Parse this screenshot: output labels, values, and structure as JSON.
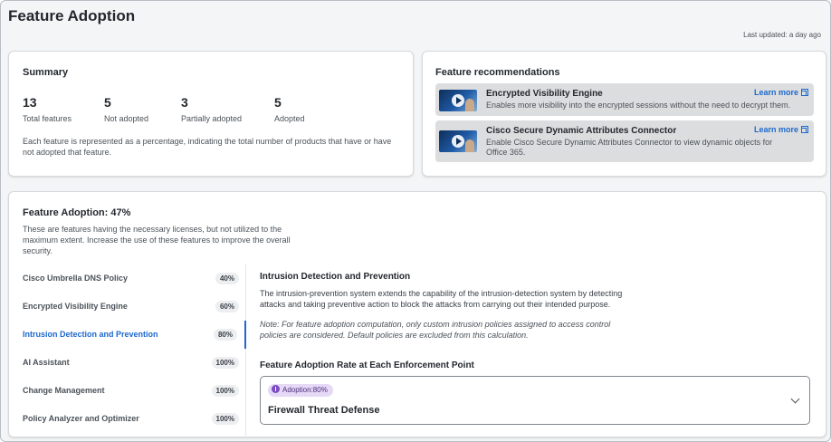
{
  "header": {
    "title": "Feature Adoption",
    "last_updated": "Last updated: a day ago"
  },
  "summary": {
    "title": "Summary",
    "stats": [
      {
        "value": "13",
        "label": "Total features"
      },
      {
        "value": "5",
        "label": "Not adopted"
      },
      {
        "value": "3",
        "label": "Partially adopted"
      },
      {
        "value": "5",
        "label": "Adopted"
      }
    ],
    "note": "Each feature is represented as a percentage, indicating the total number of products that have or have not adopted that feature."
  },
  "recommendations": {
    "title": "Feature recommendations",
    "items": [
      {
        "name": "Encrypted Visibility Engine",
        "description": "Enables more visibility into the encrypted sessions without the need to decrypt them.",
        "link": "Learn more"
      },
      {
        "name": "Cisco Secure Dynamic Attributes Connector",
        "description": "Enable Cisco Secure Dynamic Attributes Connector to view dynamic objects for Office 365.",
        "link": "Learn more"
      }
    ]
  },
  "adoption": {
    "title": "Feature Adoption: 47%",
    "description": "These are features having the necessary licenses, but not utilized to the maximum extent. Increase the use of these features to improve the overall security.",
    "features": [
      {
        "name": "Cisco Umbrella DNS Policy",
        "percent": "40%"
      },
      {
        "name": "Encrypted Visibility Engine",
        "percent": "60%"
      },
      {
        "name": "Intrusion Detection and Prevention",
        "percent": "80%"
      },
      {
        "name": "AI Assistant",
        "percent": "100%"
      },
      {
        "name": "Change Management",
        "percent": "100%"
      },
      {
        "name": "Policy Analyzer and Optimizer",
        "percent": "100%"
      }
    ],
    "selected_index": 2,
    "detail": {
      "title": "Intrusion Detection and Prevention",
      "description": "The intrusion-prevention system extends the capability of the intrusion-detection system by detecting attacks and taking preventive action to block the attacks from carrying out their intended purpose.",
      "note": "Note: For feature adoption computation, only custom intrusion policies assigned to access control policies are considered. Default policies are excluded from this calculation.",
      "rate_title": "Feature Adoption Rate at Each Enforcement Point",
      "enforcement_point": {
        "badge": "Adoption:80%",
        "name": "Firewall Threat Defense"
      }
    }
  },
  "colors": {
    "accent": "#1d69cc",
    "badge_purple": "#e6d9f6",
    "background": "#f4f5f6"
  }
}
